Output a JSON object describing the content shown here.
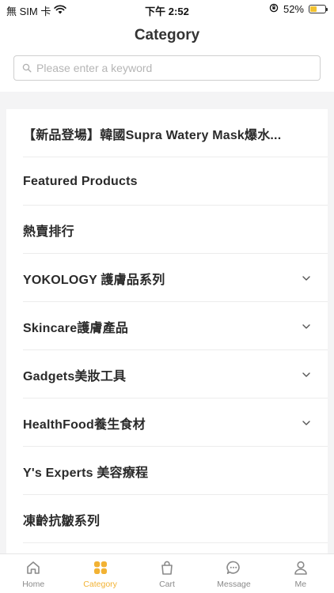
{
  "status_bar": {
    "carrier": "無 SIM 卡",
    "time": "下午 2:52",
    "battery_percent": "52%",
    "battery_level": 0.52
  },
  "header": {
    "title": "Category"
  },
  "search": {
    "placeholder": "Please enter a keyword",
    "value": ""
  },
  "categories": [
    {
      "label": "【新品登場】韓國Supra Watery Mask爆水...",
      "has_chevron": false
    },
    {
      "label": "Featured Products",
      "has_chevron": false
    },
    {
      "label": "熱賣排行",
      "has_chevron": false
    },
    {
      "label": "YOKOLOGY 護膚品系列",
      "has_chevron": true
    },
    {
      "label": "Skincare護膚產品",
      "has_chevron": true
    },
    {
      "label": "Gadgets美妝工具",
      "has_chevron": true
    },
    {
      "label": "HealthFood養生食材",
      "has_chevron": true
    },
    {
      "label": "Y's Experts 美容療程",
      "has_chevron": false
    },
    {
      "label": "凍齡抗皺系列",
      "has_chevron": false
    }
  ],
  "tab_bar": {
    "tabs": [
      {
        "label": "Home",
        "icon": "home-icon",
        "active": false
      },
      {
        "label": "Category",
        "icon": "category-icon",
        "active": true
      },
      {
        "label": "Cart",
        "icon": "cart-icon",
        "active": false
      },
      {
        "label": "Message",
        "icon": "message-icon",
        "active": false
      },
      {
        "label": "Me",
        "icon": "user-icon",
        "active": false
      }
    ]
  },
  "colors": {
    "accent": "#f2b233",
    "inactive_tab": "#8a8a8a",
    "background": "#f4f4f5"
  }
}
